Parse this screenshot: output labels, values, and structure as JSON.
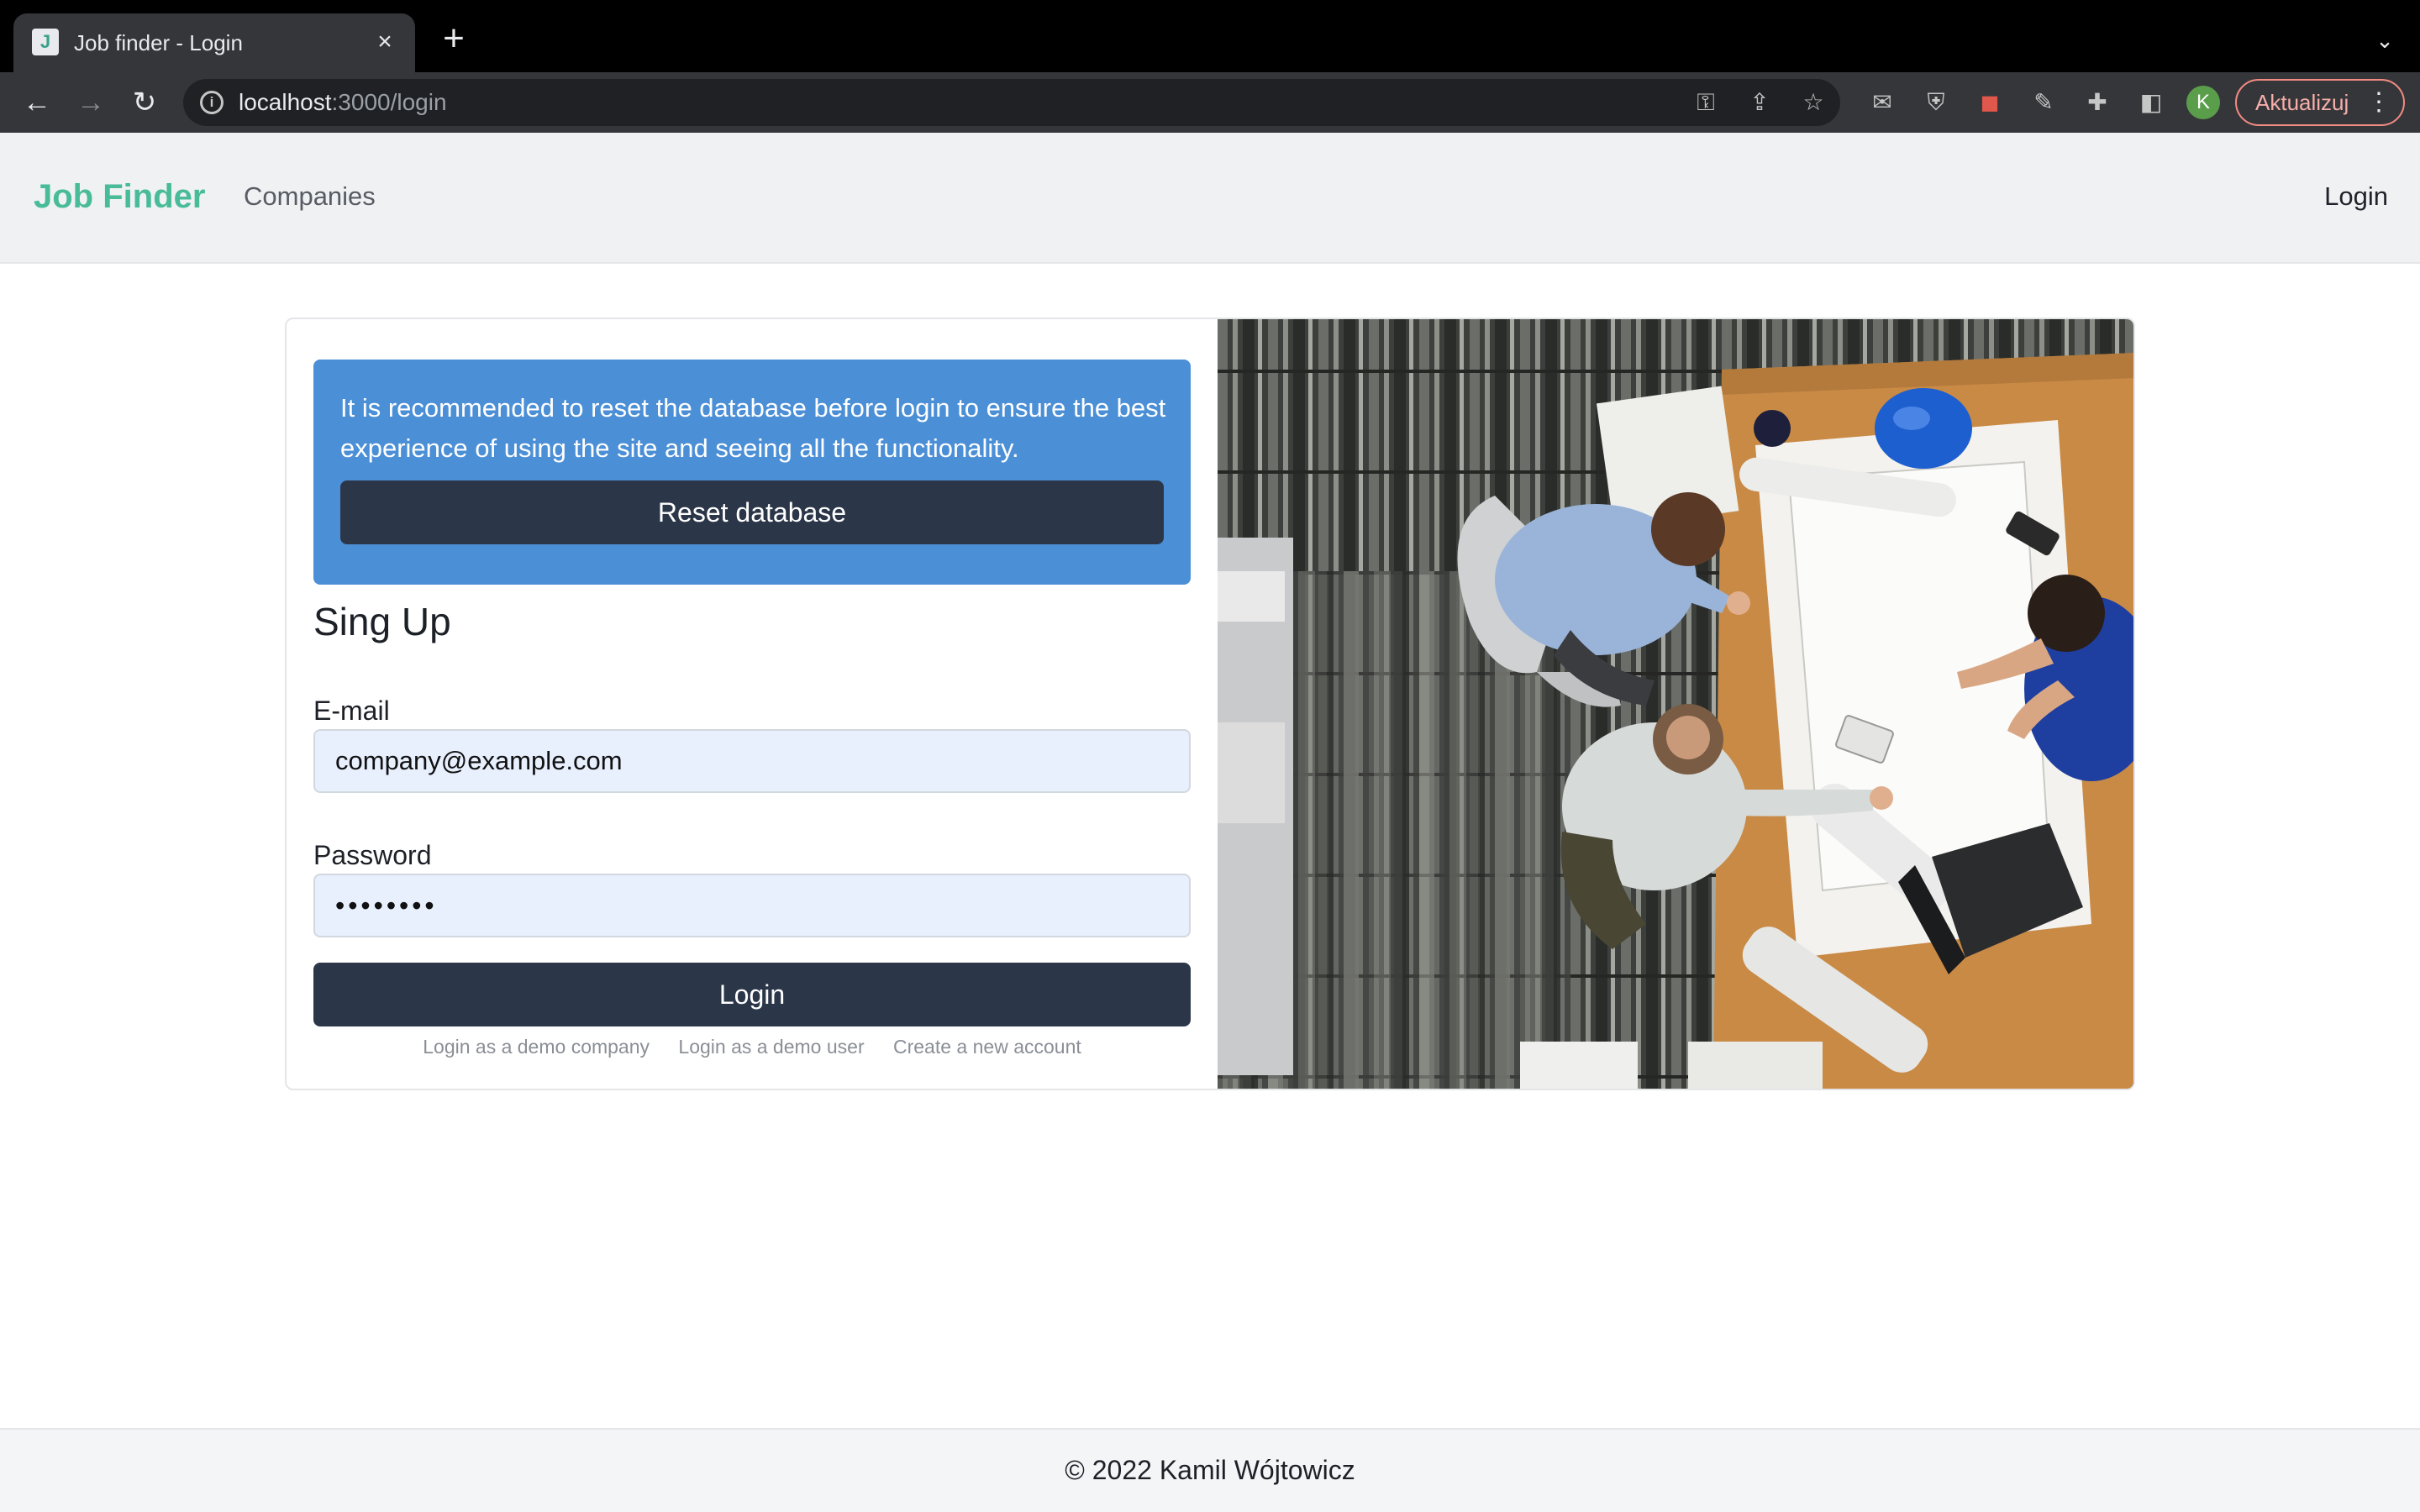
{
  "browser": {
    "tab_title": "Job finder - Login",
    "favicon_letter": "J",
    "url_host": "localhost",
    "url_path": ":3000/login",
    "update_label": "Aktualizuj",
    "profile_initial": "K"
  },
  "navbar": {
    "brand": "Job Finder",
    "companies": "Companies",
    "login": "Login"
  },
  "alert": {
    "text": "It is recommended to reset the database before login to ensure the best experience of using the site and seeing all the functionality.",
    "reset_label": "Reset database"
  },
  "form": {
    "title": "Sing Up",
    "email_label": "E-mail",
    "email_value": "company@example.com",
    "password_label": "Password",
    "password_value": "••••••••",
    "login_label": "Login",
    "links": [
      "Login as a demo company",
      "Login as a demo user",
      "Create a new account"
    ]
  },
  "footer": {
    "text": "© 2022 Kamil Wójtowicz"
  },
  "colors": {
    "brand": "#48bb98",
    "alert_bg": "#4b8fd6",
    "button_bg": "#2b3749",
    "input_bg": "#e8f0fe"
  }
}
